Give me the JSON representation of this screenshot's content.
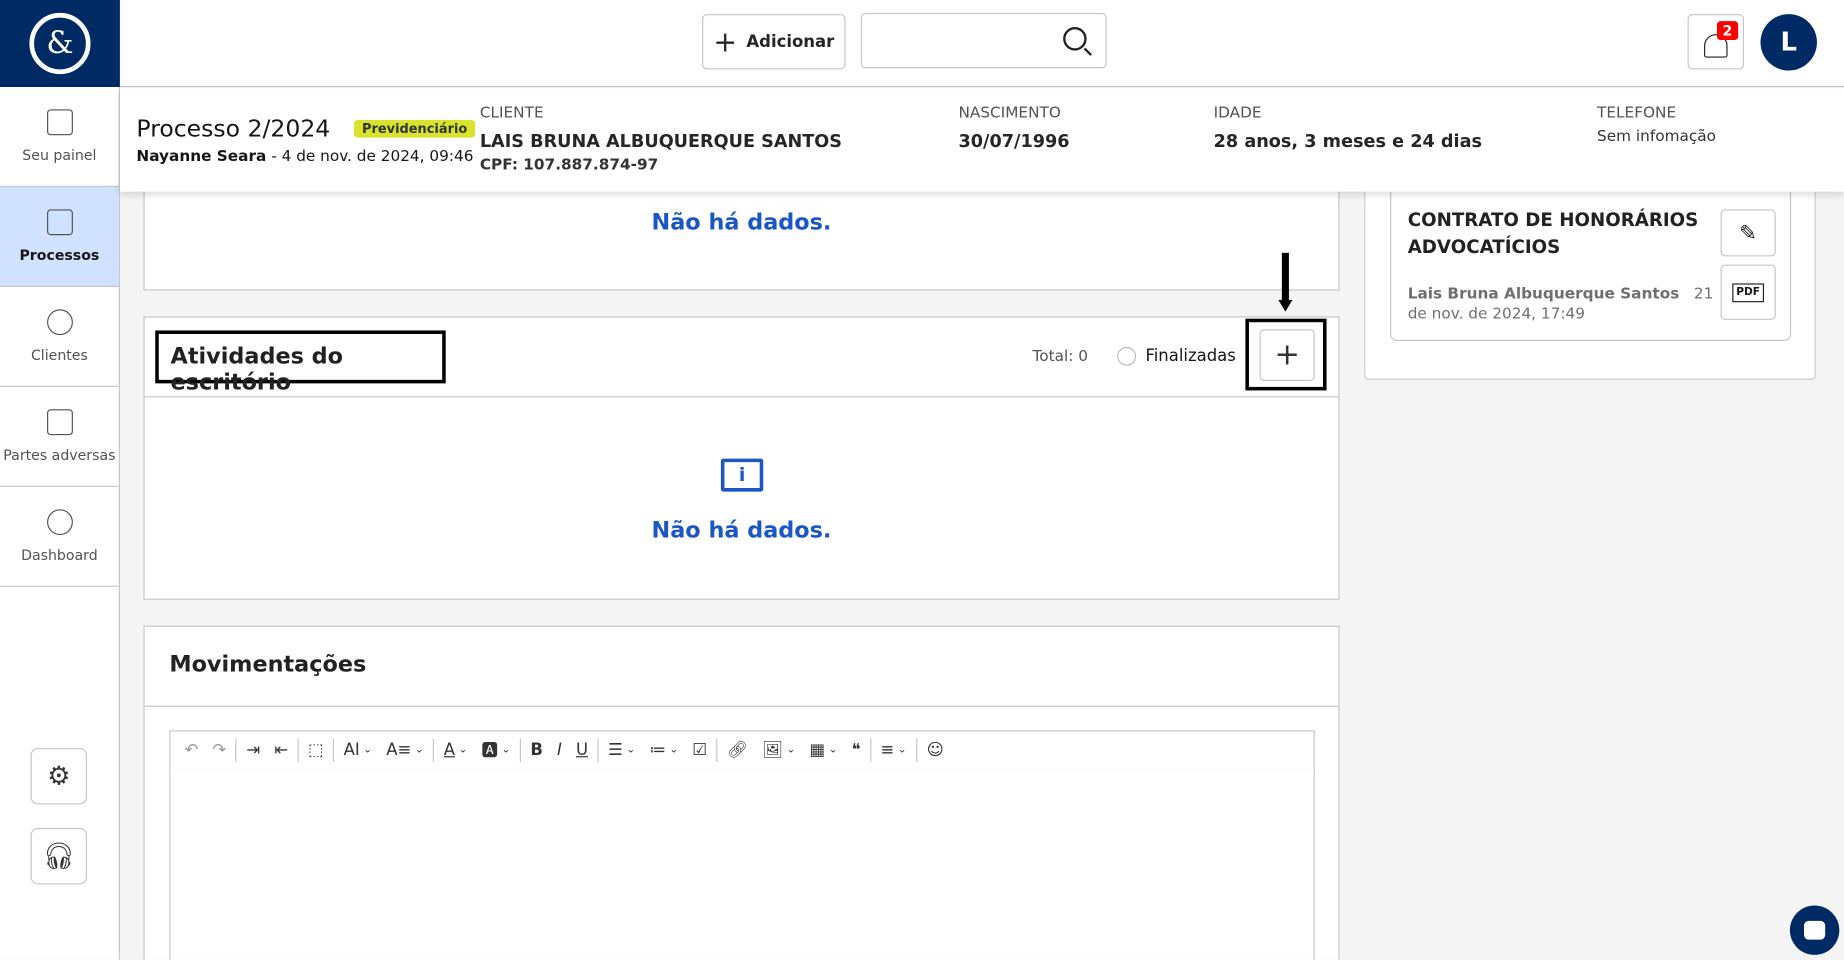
{
  "topbar": {
    "logo": "&",
    "add_label": "Adicionar",
    "search_placeholder": "",
    "notifications_count": "2",
    "avatar_initial": "L"
  },
  "sidebar": {
    "items": [
      {
        "label": "Seu painel",
        "icon": "list-icon"
      },
      {
        "label": "Processos",
        "icon": "stack-icon",
        "active": true
      },
      {
        "label": "Clientes",
        "icon": "user-icon"
      },
      {
        "label": "Partes adversas",
        "icon": "document-icon"
      },
      {
        "label": "Dashboard",
        "icon": "pie-chart-icon"
      }
    ]
  },
  "header": {
    "title": "Processo 2/2024",
    "tag": "Previdenciário",
    "subtitle_author": "Nayanne Seara",
    "subtitle_date": " - 4 de nov. de 2024, 09:46",
    "cliente_label": "CLIENTE",
    "cliente_name": "LAIS BRUNA ALBUQUERQUE SANTOS",
    "cpf": "CPF: 107.887.874-97",
    "nascimento_label": "NASCIMENTO",
    "nascimento": "30/07/1996",
    "idade_label": "IDADE",
    "idade": "28 anos, 3 meses e 24 dias",
    "telefone_label": "TELEFONE",
    "telefone": "Sem infomação"
  },
  "top_card": {
    "empty": "Não há dados."
  },
  "atividades": {
    "title": "Atividades do escritório",
    "total": "Total: 0",
    "finalizadas": "Finalizadas",
    "empty": "Não há dados."
  },
  "movimentacoes": {
    "title": "Movimentações",
    "toolbar": [
      "undo",
      "redo",
      "|",
      "indent",
      "outdent",
      "|",
      "select-all",
      "|",
      "font-size",
      "text-style",
      "|",
      "font-color",
      "background-color",
      "|",
      "bold",
      "italic",
      "underline",
      "|",
      "bulleted-list",
      "numbered-list",
      "todo-list",
      "|",
      "link",
      "insert-image",
      "insert-table",
      "block-quote",
      "|",
      "align",
      "|",
      "accessibility"
    ]
  },
  "contract": {
    "title": "CONTRATO DE HONORÁRIOS ADVOCATÍCIOS",
    "author": "Lais Bruna Albuquerque Santos",
    "date": "21 de nov. de 2024, 17:49"
  }
}
